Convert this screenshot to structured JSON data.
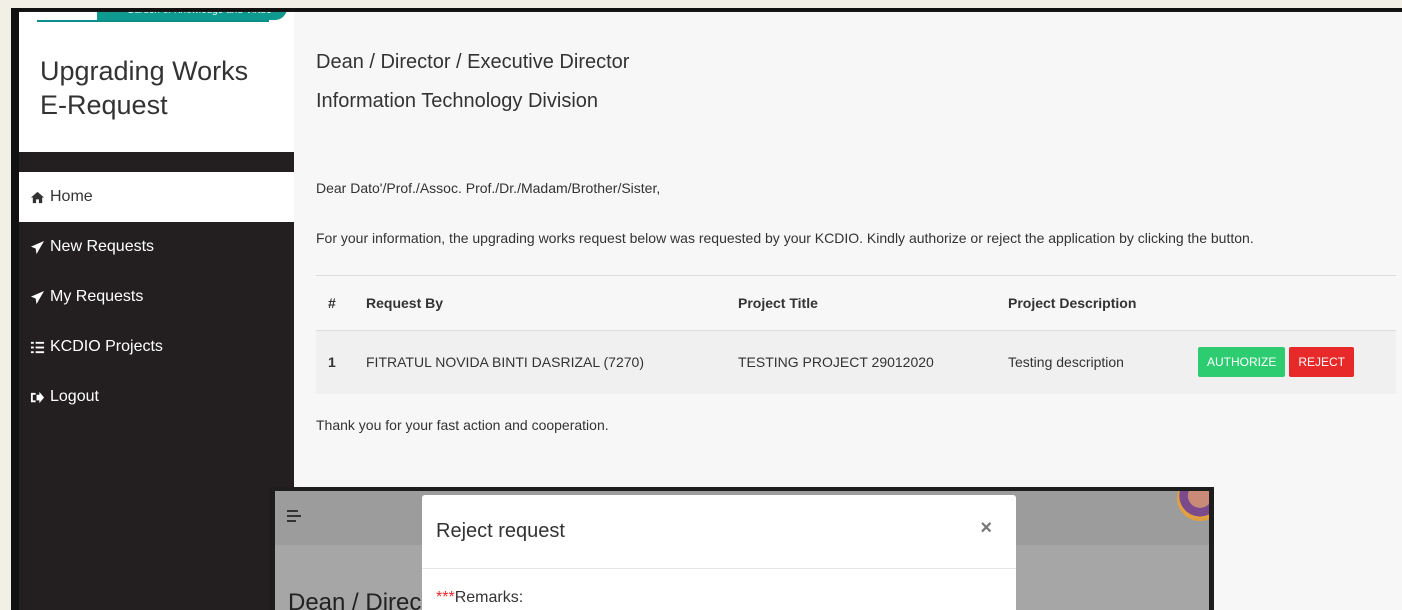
{
  "brand": {
    "tagline": "Garden of Knowledge and Virtue",
    "app_title_line1": "Upgrading Works",
    "app_title_line2": "E-Request"
  },
  "nav": {
    "items": [
      {
        "label": "Home",
        "icon": "home-icon"
      },
      {
        "label": "New Requests",
        "icon": "send-icon"
      },
      {
        "label": "My Requests",
        "icon": "send-icon"
      },
      {
        "label": "KCDIO Projects",
        "icon": "list-icon"
      },
      {
        "label": "Logout",
        "icon": "logout-icon"
      }
    ]
  },
  "main": {
    "heading_line1": "Dean / Director / Executive Director",
    "heading_line2": "Information Technology Division",
    "salutation": "Dear Dato'/Prof./Assoc. Prof./Dr./Madam/Brother/Sister,",
    "info": "For your information, the upgrading works request below was requested by your KCDIO. Kindly authorize or reject the application by clicking the button.",
    "table": {
      "headers": [
        "#",
        "Request By",
        "Project Title",
        "Project Description",
        ""
      ],
      "rows": [
        {
          "num": "1",
          "request_by": "FITRATUL NOVIDA BINTI DASRIZAL (7270)",
          "project_title": "TESTING PROJECT 29012020",
          "project_description": "Testing description",
          "authorize_label": "AUTHORIZE",
          "reject_label": "REJECT"
        }
      ]
    },
    "thanks": "Thank you for your fast action and cooperation."
  },
  "modal": {
    "title": "Reject request",
    "close": "×",
    "required_mark": "***",
    "remarks_label": "Remarks:",
    "background_heading": "Dean / Direc"
  },
  "colors": {
    "sidebar": "#231f20",
    "authorize": "#2ecc71",
    "reject": "#e8292a",
    "brand_teal": "#0e9a8e"
  }
}
